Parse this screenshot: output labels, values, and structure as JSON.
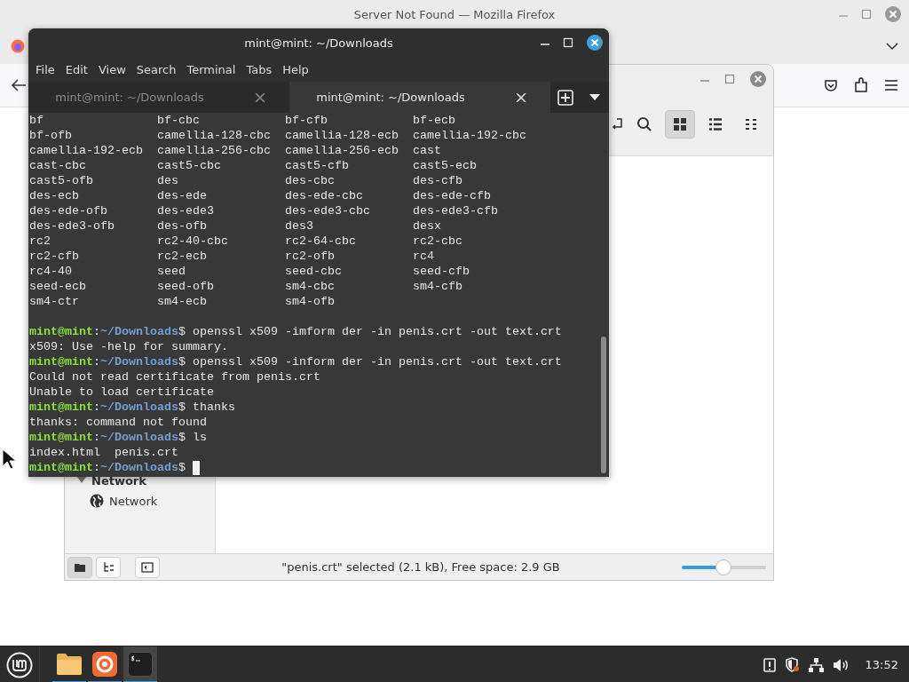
{
  "firefox": {
    "title": "Server Not Found — Mozilla Firefox"
  },
  "file_manager": {
    "view_buttons": [
      {
        "kind": "grid",
        "selected": true
      },
      {
        "kind": "list",
        "selected": false
      },
      {
        "kind": "compact",
        "selected": false
      }
    ],
    "sidebar": {
      "section": "Network",
      "items": [
        {
          "label": "Network"
        }
      ]
    },
    "status_bar": {
      "pane_buttons": [
        {
          "kind": "places",
          "selected": true
        },
        {
          "kind": "tree",
          "selected": false
        },
        {
          "kind": "split",
          "selected": false
        }
      ],
      "text": "\"penis.crt\" selected (2.1 kB), Free space: 2.9 GB",
      "zoom": {
        "level": 0.49
      }
    }
  },
  "terminal": {
    "title": "mint@mint: ~/Downloads",
    "menu": [
      "File",
      "Edit",
      "View",
      "Search",
      "Terminal",
      "Tabs",
      "Help"
    ],
    "tabs": [
      {
        "label": "mint@mint: ~/Downloads",
        "selected": false
      },
      {
        "label": "mint@mint: ~/Downloads",
        "selected": true
      }
    ],
    "lines": [
      {
        "kind": "columns",
        "cells": [
          "bf",
          "bf-cbc",
          "bf-cfb",
          "bf-ecb"
        ]
      },
      {
        "kind": "columns",
        "cells": [
          "bf-ofb",
          "camellia-128-cbc",
          "camellia-128-ecb",
          "camellia-192-cbc"
        ]
      },
      {
        "kind": "columns",
        "cells": [
          "camellia-192-ecb",
          "camellia-256-cbc",
          "camellia-256-ecb",
          "cast"
        ]
      },
      {
        "kind": "columns",
        "cells": [
          "cast-cbc",
          "cast5-cbc",
          "cast5-cfb",
          "cast5-ecb"
        ]
      },
      {
        "kind": "columns",
        "cells": [
          "cast5-ofb",
          "des",
          "des-cbc",
          "des-cfb"
        ]
      },
      {
        "kind": "columns",
        "cells": [
          "des-ecb",
          "des-ede",
          "des-ede-cbc",
          "des-ede-cfb"
        ]
      },
      {
        "kind": "columns",
        "cells": [
          "des-ede-ofb",
          "des-ede3",
          "des-ede3-cbc",
          "des-ede3-cfb"
        ]
      },
      {
        "kind": "columns",
        "cells": [
          "des-ede3-ofb",
          "des-ofb",
          "des3",
          "desx"
        ]
      },
      {
        "kind": "columns",
        "cells": [
          "rc2",
          "rc2-40-cbc",
          "rc2-64-cbc",
          "rc2-cbc"
        ]
      },
      {
        "kind": "columns",
        "cells": [
          "rc2-cfb",
          "rc2-ecb",
          "rc2-ofb",
          "rc4"
        ]
      },
      {
        "kind": "columns",
        "cells": [
          "rc4-40",
          "seed",
          "seed-cbc",
          "seed-cfb"
        ]
      },
      {
        "kind": "columns",
        "cells": [
          "seed-ecb",
          "seed-ofb",
          "sm4-cbc",
          "sm4-cfb"
        ]
      },
      {
        "kind": "columns",
        "cells": [
          "sm4-ctr",
          "sm4-ecb",
          "sm4-ofb"
        ]
      },
      {
        "kind": "blank"
      },
      {
        "kind": "prompt",
        "user": "mint@mint",
        "separator": ":",
        "path": "~/Downloads",
        "symbol": "$",
        "command": "openssl x509 -imform der -in penis.crt -out text.crt",
        "cursor": false
      },
      {
        "kind": "output",
        "text": "x509: Use -help for summary."
      },
      {
        "kind": "prompt",
        "user": "mint@mint",
        "separator": ":",
        "path": "~/Downloads",
        "symbol": "$",
        "command": "openssl x509 -inform der -in penis.crt -out text.crt",
        "cursor": false
      },
      {
        "kind": "output",
        "text": "Could not read certificate from penis.crt"
      },
      {
        "kind": "output",
        "text": "Unable to load certificate"
      },
      {
        "kind": "prompt",
        "user": "mint@mint",
        "separator": ":",
        "path": "~/Downloads",
        "symbol": "$",
        "command": "thanks",
        "cursor": false
      },
      {
        "kind": "output",
        "text": "thanks: command not found"
      },
      {
        "kind": "prompt",
        "user": "mint@mint",
        "separator": ":",
        "path": "~/Downloads",
        "symbol": "$",
        "command": "ls",
        "cursor": false
      },
      {
        "kind": "output",
        "text": "index.html  penis.crt"
      },
      {
        "kind": "prompt",
        "user": "mint@mint",
        "separator": ":",
        "path": "~/Downloads",
        "symbol": "$",
        "cursor": true
      }
    ]
  },
  "taskbar": {
    "apps": [
      {
        "kind": "files",
        "active": false
      },
      {
        "kind": "firefox",
        "active": false
      },
      {
        "kind": "terminal",
        "active": true
      }
    ],
    "tray": [
      {
        "kind": "update"
      },
      {
        "kind": "shield"
      },
      {
        "kind": "network"
      },
      {
        "kind": "volume"
      }
    ],
    "clock": "13:52"
  }
}
